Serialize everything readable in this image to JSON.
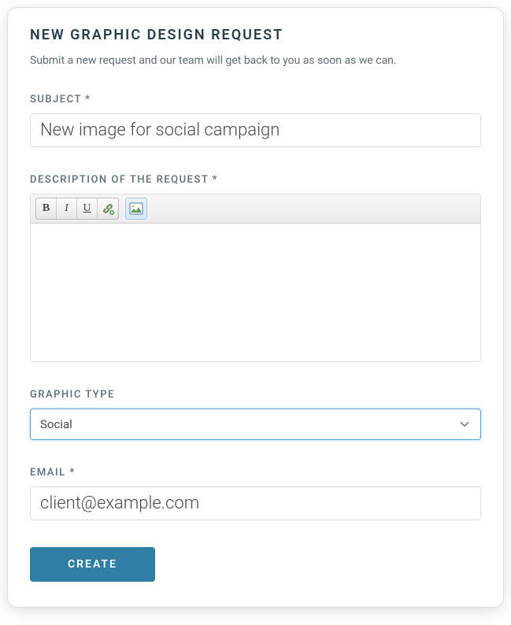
{
  "form": {
    "title": "NEW GRAPHIC DESIGN REQUEST",
    "subtitle": "Submit a new request and our team will get back to you as soon as we can.",
    "subject": {
      "label": "SUBJECT *",
      "value": "New image for social campaign"
    },
    "description": {
      "label": "DESCRIPTION OF THE REQUEST *",
      "toolbar": {
        "bold": "B",
        "italic": "I",
        "underline": "U"
      },
      "value": ""
    },
    "graphicType": {
      "label": "GRAPHIC TYPE",
      "selected": "Social"
    },
    "email": {
      "label": "EMAIL *",
      "value": "client@example.com"
    },
    "submit": "CREATE"
  }
}
